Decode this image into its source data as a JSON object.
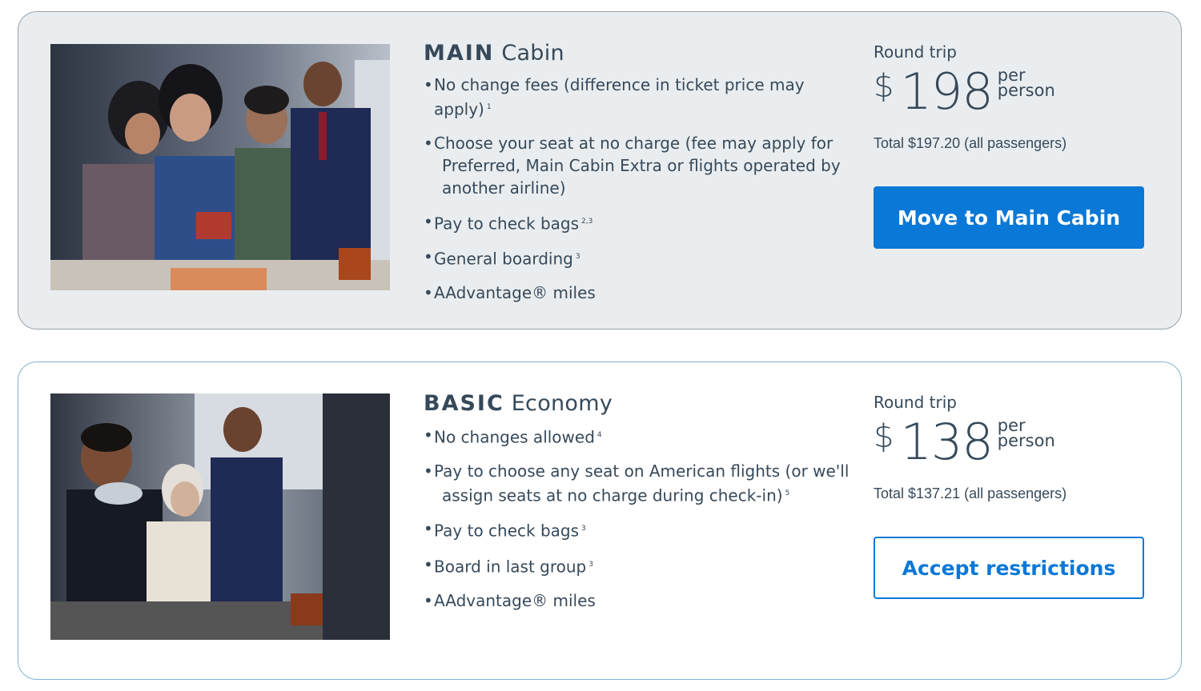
{
  "fares": {
    "main": {
      "title_strong": "MAIN",
      "title_light": "Cabin",
      "photo_desc": "Passengers in main cabin with flight attendant",
      "features": [
        {
          "text": "No change fees (difference in ticket price may apply)",
          "note": "1"
        },
        {
          "text": "Choose your seat at no charge (fee may apply for",
          "text_cont": "Preferred, Main Cabin Extra or flights operated by another airline)",
          "note": ""
        },
        {
          "text": "Pay to check bags",
          "note": "2,3"
        },
        {
          "text": "General boarding",
          "note": "3"
        },
        {
          "text": "AAdvantage® miles",
          "note": ""
        }
      ],
      "round_trip_label": "Round trip",
      "currency": "$",
      "price": "198",
      "per_line1": "per",
      "per_line2": "person",
      "total": "Total $197.20 (all passengers)",
      "button_label": "Move to Main Cabin"
    },
    "basic": {
      "title_strong": "BASIC",
      "title_light": "Economy",
      "photo_desc": "Passengers in basic economy with flight attendant",
      "features": [
        {
          "text": "No changes allowed",
          "note": "4"
        },
        {
          "text": "Pay to choose any seat on American flights (or we'll",
          "text_cont": "assign seats at no charge during check-in)",
          "note": "5"
        },
        {
          "text": "Pay to check bags",
          "note": "3"
        },
        {
          "text": "Board in last group",
          "note": "3"
        },
        {
          "text": "AAdvantage® miles",
          "note": ""
        }
      ],
      "round_trip_label": "Round trip",
      "currency": "$",
      "price": "138",
      "per_line1": "per",
      "per_line2": "person",
      "total": "Total $137.21 (all passengers)",
      "button_label": "Accept restrictions"
    }
  },
  "colors": {
    "accent": "#0a78d7",
    "text": "#36495a",
    "main_card_bg": "#eaedef"
  }
}
